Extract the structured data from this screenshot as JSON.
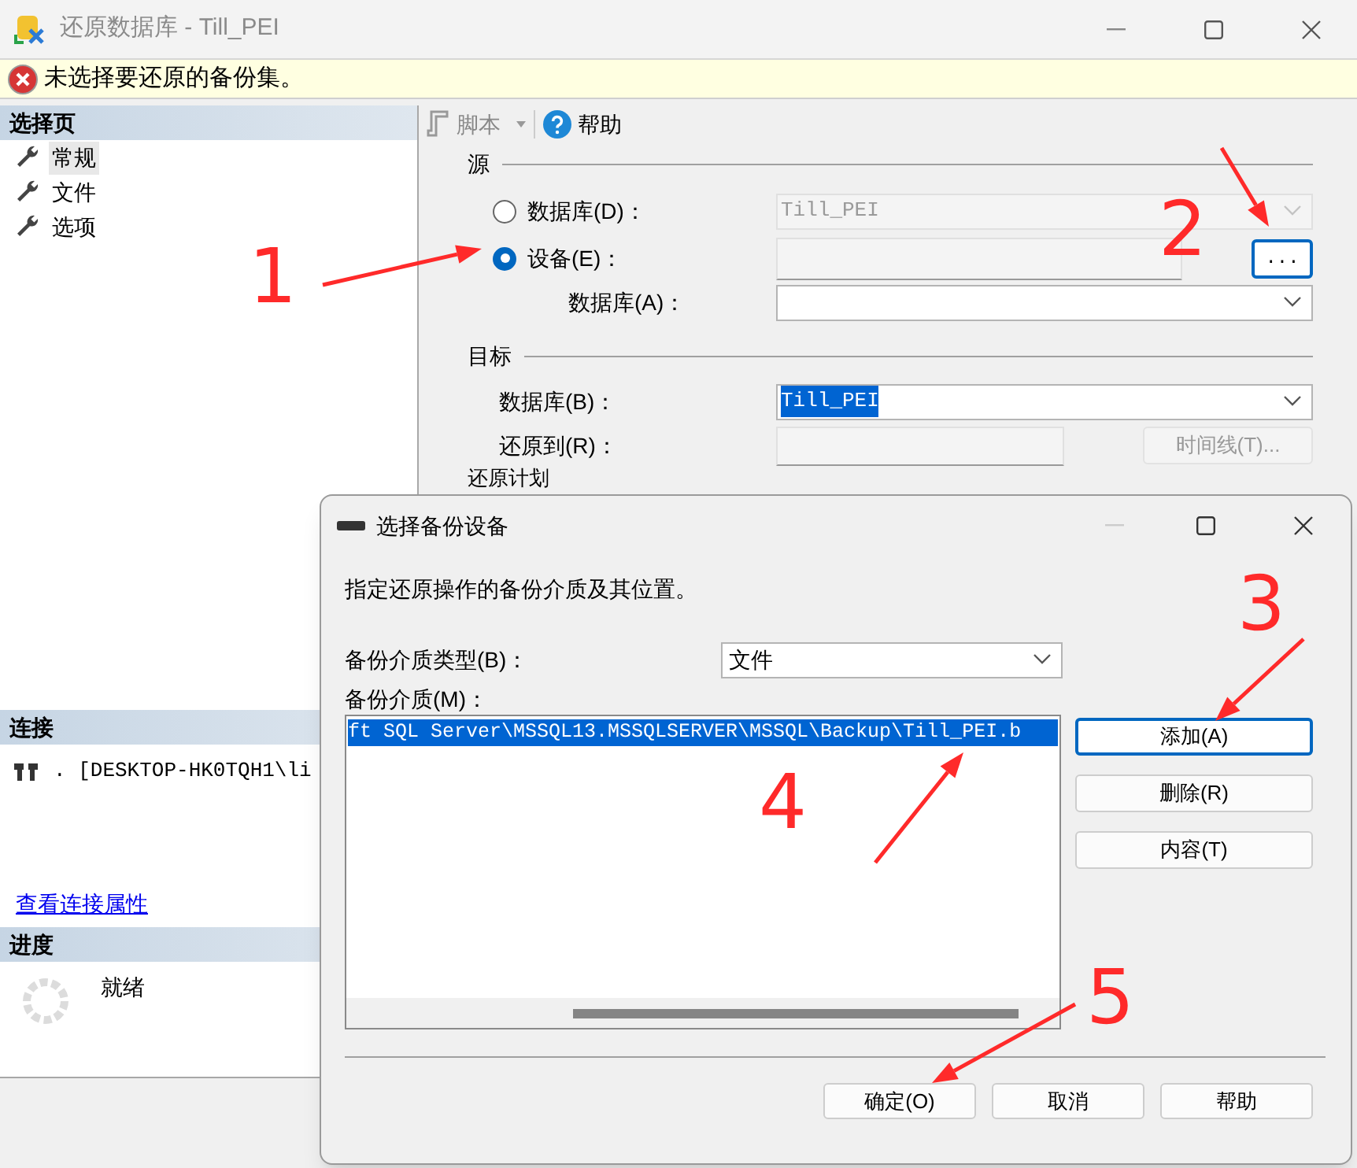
{
  "window": {
    "title": "还原数据库 - Till_PEI"
  },
  "error_bar": {
    "message": "未选择要还原的备份集。"
  },
  "sidebar": {
    "pages_header": "选择页",
    "pages": [
      {
        "label": "常规",
        "selected": true
      },
      {
        "label": "文件",
        "selected": false
      },
      {
        "label": "选项",
        "selected": false
      }
    ],
    "connection_header": "连接",
    "connection": ". [DESKTOP-HK0TQH1\\li",
    "connection_link": "查看连接属性",
    "progress_header": "进度",
    "progress_status": "就绪"
  },
  "toolbar": {
    "script": "脚本",
    "help": "帮助"
  },
  "source": {
    "title": "源",
    "options": [
      {
        "label": "数据库(D)：",
        "selected": false
      },
      {
        "label": "设备(E)：",
        "selected": true
      }
    ],
    "database_combo": {
      "value": "Till_PEI",
      "disabled": true
    },
    "browse_button": "...",
    "source_database_label": "数据库(A)："
  },
  "target": {
    "title": "目标",
    "database_label": "数据库(B)：",
    "database_value": "Till_PEI",
    "restore_to_label": "还原到(R)：",
    "timeline_button": {
      "label": "时间线(T)...",
      "disabled": true
    },
    "next_section": "还原计划"
  },
  "dialog": {
    "title": "选择备份设备",
    "description": "指定还原操作的备份介质及其位置。",
    "media_type_label": "备份介质类型(B)：",
    "media_type_value": "文件",
    "media_label": "备份介质(M)：",
    "media_items": [
      {
        "path": "ft SQL Server\\MSSQL13.MSSQLSERVER\\MSSQL\\Backup\\Till_PEI.b",
        "selected": true
      }
    ],
    "side_buttons": [
      {
        "label": "添加(A)",
        "focused": true
      },
      {
        "label": "删除(R)",
        "focused": false
      },
      {
        "label": "内容(T)",
        "focused": false
      }
    ],
    "buttons": [
      "确定(O)",
      "取消",
      "帮助"
    ]
  },
  "annotations": [
    {
      "label": "1"
    },
    {
      "label": "2"
    },
    {
      "label": "3"
    },
    {
      "label": "4"
    },
    {
      "label": "5"
    }
  ]
}
